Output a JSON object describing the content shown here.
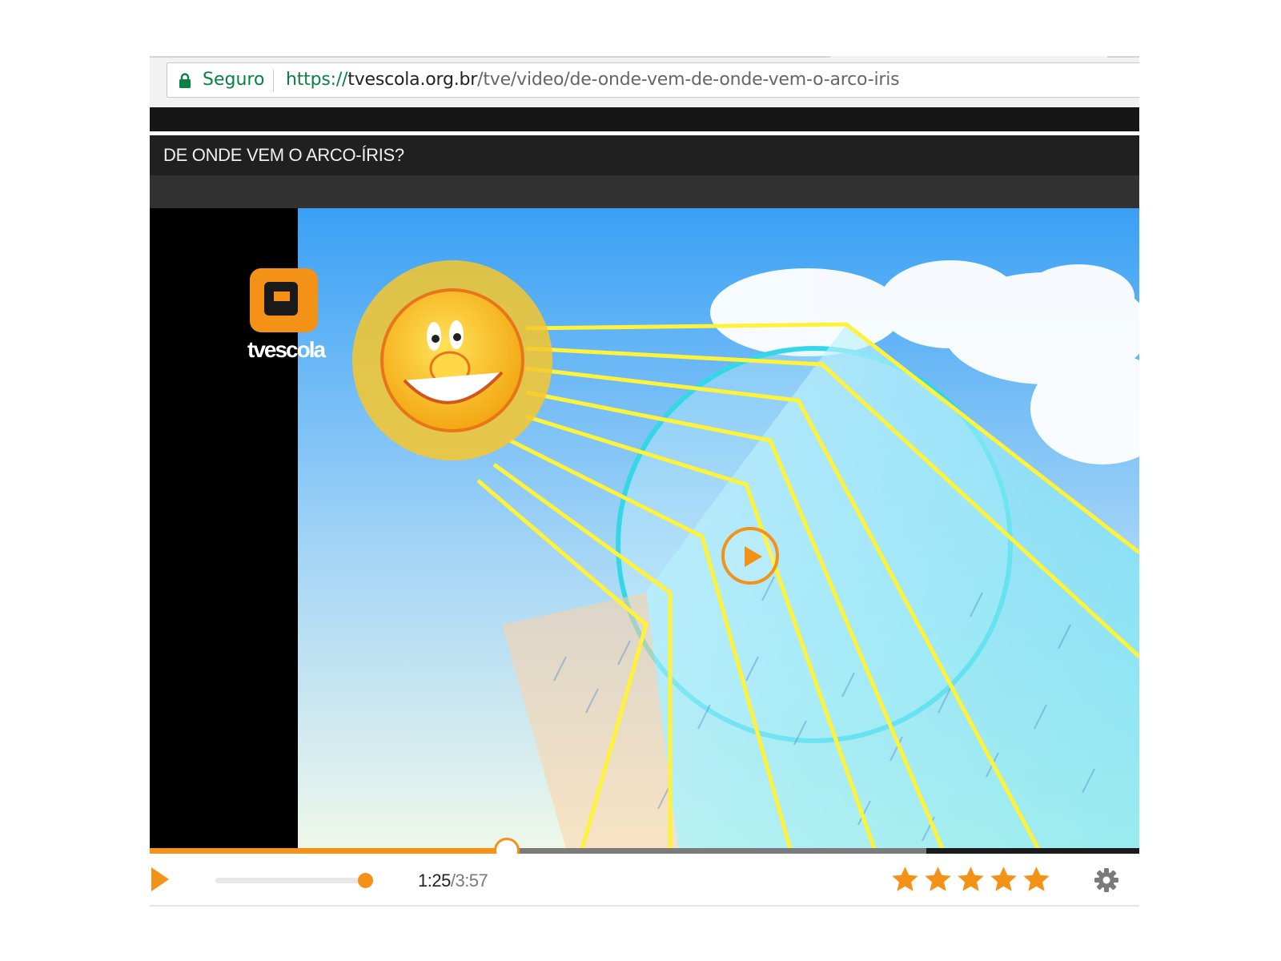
{
  "browser": {
    "secure_label": "Seguro",
    "url_scheme": "https://",
    "url_host": "tvescola.org.br",
    "url_path": "/tve/video/de-onde-vem-de-onde-vem-o-arco-iris"
  },
  "video": {
    "title": "DE ONDE VEM O ARCO-ÍRIS?",
    "logo_text": "tvescola"
  },
  "player": {
    "current_time": "1:25",
    "separator": "/",
    "duration": "3:57",
    "progress_fraction": 0.359,
    "buffered_fraction": 0.785,
    "volume_fraction": 0.96,
    "rating_stars": 5,
    "rating_filled": 5
  },
  "colors": {
    "accent": "#f39217",
    "secure": "#0b8043",
    "sky_top": "#3aa0f5",
    "sky_bottom": "#eaf6f4",
    "sun": "#f6c21c",
    "light_beam": "#ffee3a"
  },
  "icons": {
    "lock": "lock-icon",
    "play": "play-icon",
    "big_play": "play-circle-icon",
    "star": "star-icon",
    "settings": "gear-icon"
  }
}
